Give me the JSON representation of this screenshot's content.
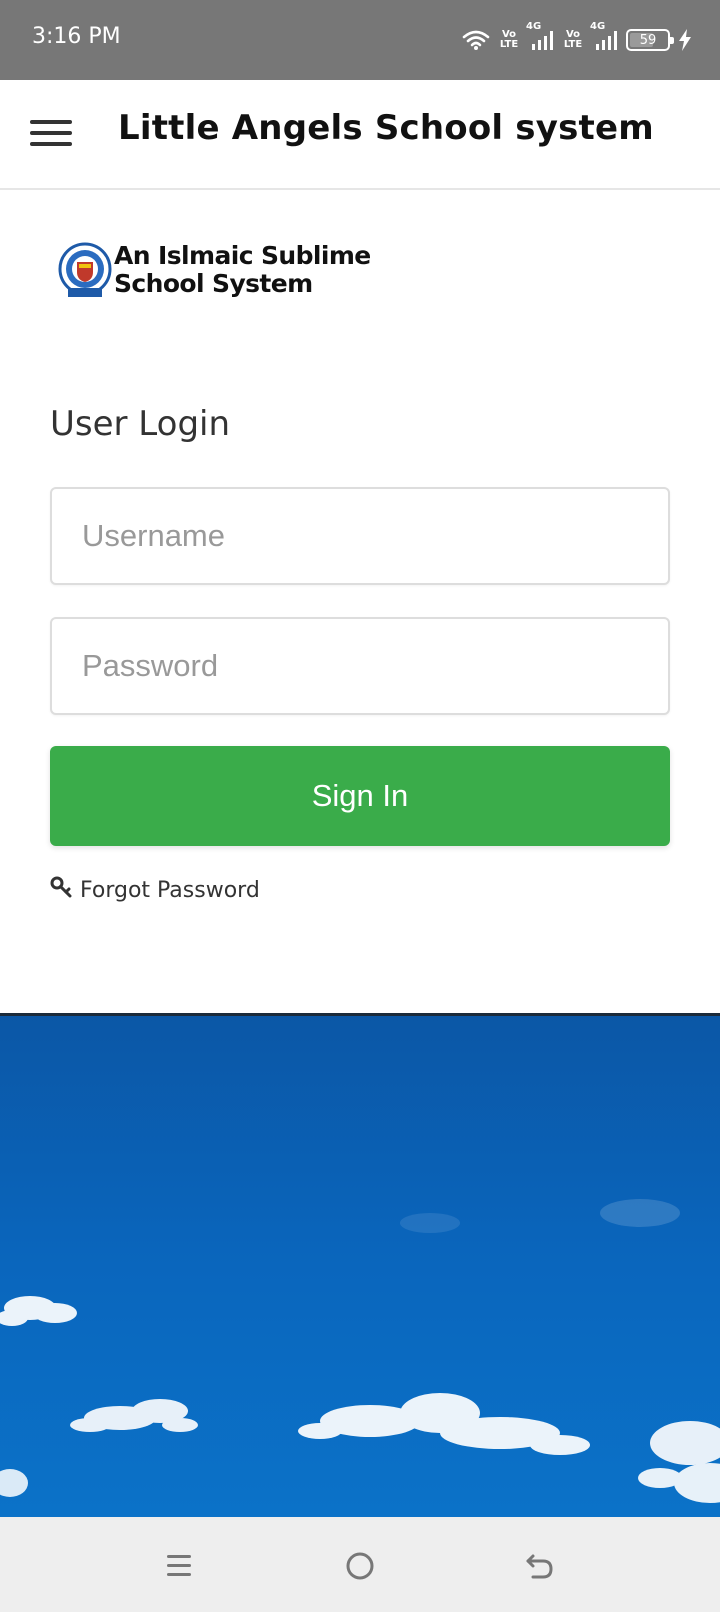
{
  "status_bar": {
    "time": "3:16 PM",
    "sim1_label": "Vo LTE",
    "sim1_network": "4G",
    "sim2_label": "Vo LTE",
    "sim2_network": "4G",
    "battery_level": "59",
    "icons": [
      "wifi-icon",
      "signal-icon",
      "signal-icon",
      "battery-icon",
      "charging-icon"
    ]
  },
  "header": {
    "title": "Little Angels School system",
    "menu_icon": "hamburger-menu-icon"
  },
  "logo": {
    "line1": "An Islmaic Sublime",
    "line2": "School System"
  },
  "login": {
    "heading": "User Login",
    "username_placeholder": "Username",
    "username_value": "",
    "password_placeholder": "Password",
    "password_value": "",
    "signin_label": "Sign In",
    "forgot_label": "Forgot Password",
    "forgot_icon": "key-icon"
  },
  "colors": {
    "status_bar": "#777777",
    "signin_button": "#3aac4a",
    "sky": "#0a63b5",
    "nav_bar": "#eeeeee"
  },
  "nav_bar": {
    "icons": [
      "recent-apps-icon",
      "home-icon",
      "back-icon"
    ]
  }
}
